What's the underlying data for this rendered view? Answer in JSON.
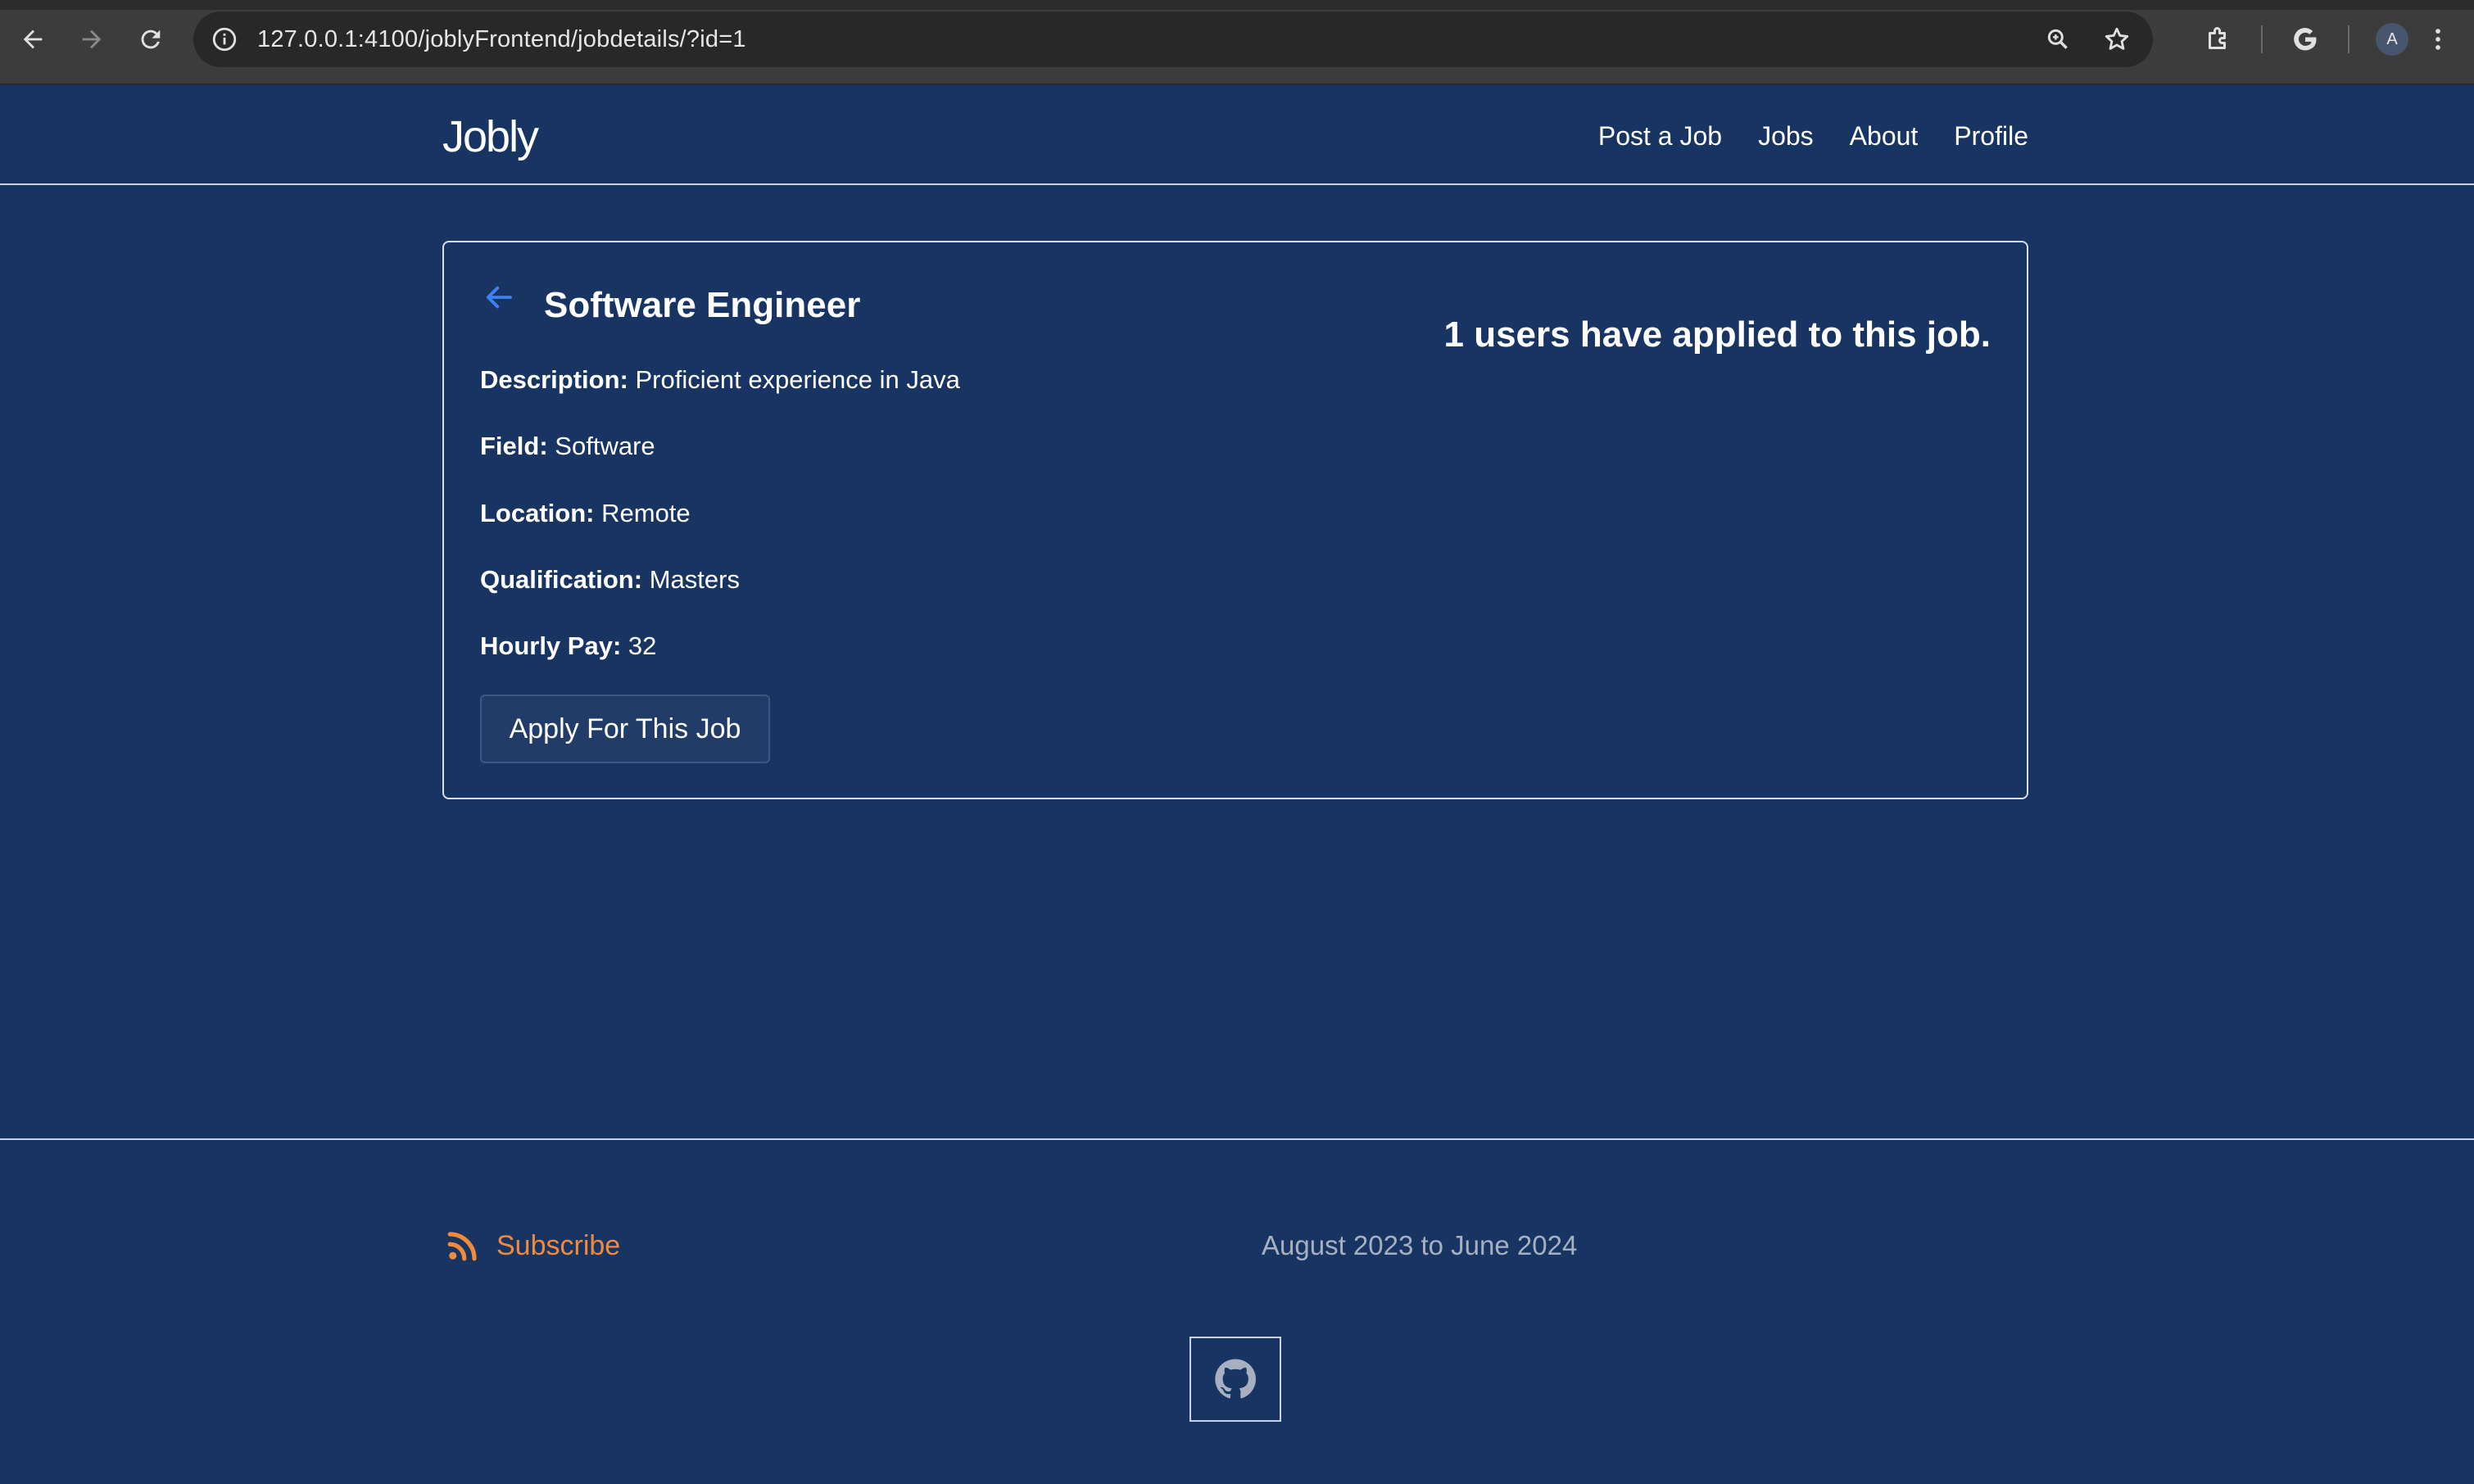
{
  "browser": {
    "url": "127.0.0.1:4100/joblyFrontend/jobdetails/?id=1",
    "avatar_letter": "A",
    "icons": [
      "back-icon",
      "forward-icon",
      "reload-icon",
      "site-info-icon",
      "zoom-icon",
      "bookmark-star-icon",
      "extensions-icon",
      "google-icon",
      "menu-dots-icon"
    ]
  },
  "navbar": {
    "brand": "Jobly",
    "links": [
      "Post a Job",
      "Jobs",
      "About",
      "Profile"
    ]
  },
  "job": {
    "title": "Software Engineer",
    "applied_text": "1 users have applied to this job.",
    "details": [
      {
        "label": "Description:",
        "value": "Proficient experience in Java"
      },
      {
        "label": "Field:",
        "value": "Software"
      },
      {
        "label": "Location:",
        "value": "Remote"
      },
      {
        "label": "Qualification:",
        "value": "Masters"
      },
      {
        "label": "Hourly Pay:",
        "value": "32"
      }
    ],
    "apply_label": "Apply For This Job"
  },
  "footer": {
    "subscribe_label": "Subscribe",
    "date_range": "August 2023 to June 2024"
  },
  "colors": {
    "page_bg": "#183462",
    "accent_link": "#3b82f6",
    "subscribe": "#f08a3c"
  }
}
